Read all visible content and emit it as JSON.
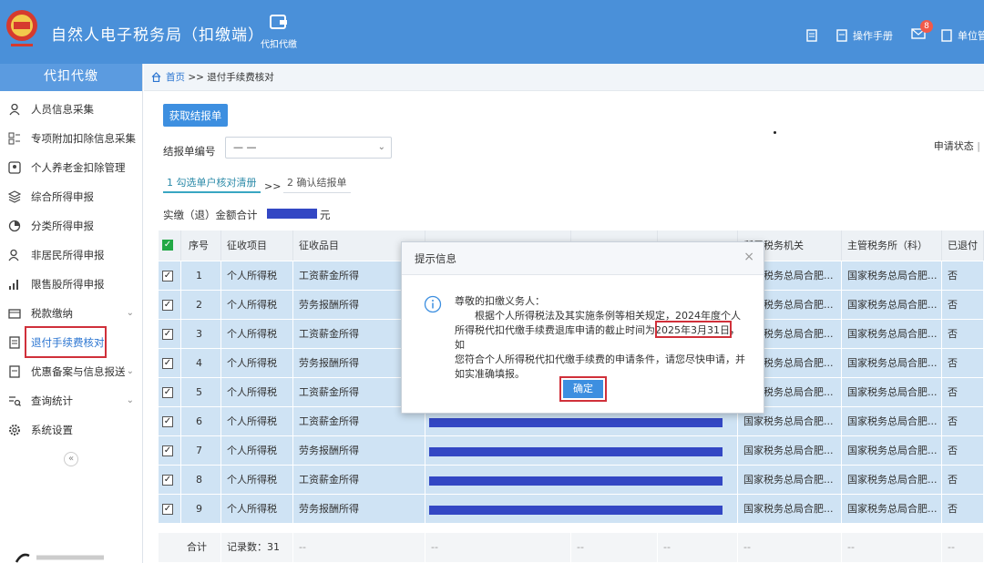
{
  "header": {
    "logo_text": "中国税务",
    "app_title": "自然人电子税务局（扣缴端）",
    "module_label": "代扣代缴",
    "manual_label": "操作手册",
    "mail_badge": "8",
    "unit_label": "单位管"
  },
  "sidebar": {
    "title": "代扣代缴",
    "items": [
      {
        "label": "人员信息采集",
        "icon": "person-icon"
      },
      {
        "label": "专项附加扣除信息采集",
        "icon": "list-icon"
      },
      {
        "label": "个人养老金扣除管理",
        "icon": "id-card-icon"
      },
      {
        "label": "综合所得申报",
        "icon": "layers-icon"
      },
      {
        "label": "分类所得申报",
        "icon": "pie-chart-icon"
      },
      {
        "label": "非居民所得申报",
        "icon": "user-globe-icon"
      },
      {
        "label": "限售股所得申报",
        "icon": "bar-chart-icon"
      },
      {
        "label": "税款缴纳",
        "icon": "wallet-icon"
      },
      {
        "label": "退付手续费核对",
        "icon": "document-icon"
      },
      {
        "label": "优惠备案与信息报送",
        "icon": "file-icon"
      },
      {
        "label": "查询统计",
        "icon": "search-list-icon"
      },
      {
        "label": "系统设置",
        "icon": "gear-icon"
      }
    ],
    "collapse_symbol": "«"
  },
  "breadcrumb": {
    "home": "首页",
    "sep": ">>",
    "current": "退付手续费核对"
  },
  "toolbar": {
    "fetch_button": "获取结报单",
    "receipt_label": "结报单编号",
    "receipt_value": "— —",
    "apply_status_label": "申请状态"
  },
  "steps": {
    "step1": "1 勾选单户核对清册",
    "sep": ">>",
    "step2": "2 确认结报单"
  },
  "total": {
    "label": "实缴（退）金额合计",
    "unit": "元"
  },
  "table": {
    "headers": [
      "序号",
      "征收项目",
      "征收品目",
      "",
      "",
      "",
      "所属税务机关",
      "主管税务所（科）",
      "已退付"
    ],
    "rows": [
      {
        "no": "1",
        "item": "个人所得税",
        "category": "工资薪金所得",
        "authority": "国家税务总局合肥...",
        "office": "国家税务总局合肥...",
        "refunded": "否"
      },
      {
        "no": "2",
        "item": "个人所得税",
        "category": "劳务报酬所得",
        "authority": "国家税务总局合肥...",
        "office": "国家税务总局合肥...",
        "refunded": "否"
      },
      {
        "no": "3",
        "item": "个人所得税",
        "category": "工资薪金所得",
        "authority": "国家税务总局合肥...",
        "office": "国家税务总局合肥...",
        "refunded": "否"
      },
      {
        "no": "4",
        "item": "个人所得税",
        "category": "劳务报酬所得",
        "authority": "国家税务总局合肥...",
        "office": "国家税务总局合肥...",
        "refunded": "否"
      },
      {
        "no": "5",
        "item": "个人所得税",
        "category": "工资薪金所得",
        "authority": "国家税务总局合肥...",
        "office": "国家税务总局合肥...",
        "refunded": "否"
      },
      {
        "no": "6",
        "item": "个人所得税",
        "category": "工资薪金所得",
        "authority": "国家税务总局合肥...",
        "office": "国家税务总局合肥...",
        "refunded": "否"
      },
      {
        "no": "7",
        "item": "个人所得税",
        "category": "劳务报酬所得",
        "authority": "国家税务总局合肥...",
        "office": "国家税务总局合肥...",
        "refunded": "否"
      },
      {
        "no": "8",
        "item": "个人所得税",
        "category": "工资薪金所得",
        "authority": "国家税务总局合肥...",
        "office": "国家税务总局合肥...",
        "refunded": "否"
      },
      {
        "no": "9",
        "item": "个人所得税",
        "category": "劳务报酬所得",
        "authority": "国家税务总局合肥...",
        "office": "国家税务总局合肥...",
        "refunded": "否"
      }
    ],
    "footer": {
      "label": "合计",
      "count": "记录数：31",
      "dash": "--"
    }
  },
  "modal": {
    "title": "提示信息",
    "close": "×",
    "greeting": "尊敬的扣缴义务人：",
    "body_line1": "　　根据个人所得税法及其实施条例等相关规定，2024年度个人",
    "body_line2": "所得税代扣代缴手续费退库申请的截止时间为2025年3月31日，如",
    "body_line3": "您符合个人所得税代扣代缴手续费的申请条件，请您尽快申请，并",
    "body_line4": "如实准确填报。",
    "ok_button": "确定"
  },
  "colors": {
    "header_bg": "#4a90d9",
    "primary": "#3d8fe0",
    "highlight_border": "#d0303a",
    "row_selected": "#cfe3f4",
    "redaction": "#3347c4"
  }
}
